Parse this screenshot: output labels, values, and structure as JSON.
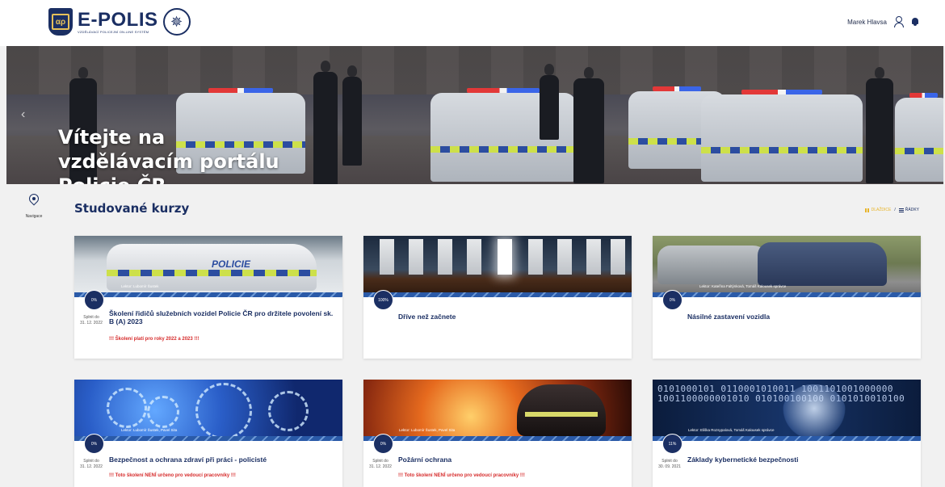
{
  "header": {
    "logo_title": "E-POLIS",
    "logo_subtitle": "VZDĚLÁVACÍ POLICEJNÍ ON-LINE SYSTÉM",
    "user_name": "Marek Hlavsa"
  },
  "hero": {
    "title": "Vítejte na vzdělávacím portálu Policie ČR"
  },
  "leftnav": {
    "label": "Navigace"
  },
  "section": {
    "title": "Studované kurzy",
    "view_tiles": "DLAŽDICE",
    "view_separator": "/",
    "view_rows": "ŘÁDKY"
  },
  "due_label": "Splnit do",
  "courses": [
    {
      "progress": "0%",
      "due_date": "31. 12. 2022",
      "lektor": "Lektor: Lubomír Šustek",
      "title": "Školení řidičů služebních vozidel Policie ČR pro držitele povolení sk. B (A) 2023",
      "note": "!!! Školení platí pro roky 2022 a 2023 !!!",
      "image_text": "POLICIE"
    },
    {
      "progress": "100%",
      "due_date": "",
      "lektor": "",
      "title": "Dříve než začnete",
      "note": ""
    },
    {
      "progress": "0%",
      "due_date": "",
      "lektor": "Lektor: Kateřina Faltýnková, Tomáš Kalousek správce",
      "title": "Násilné zastavení vozidla",
      "note": ""
    },
    {
      "progress": "0%",
      "due_date": "31. 12. 2022",
      "lektor": "Lektor: Lubomír Šustek, Pavel Sita",
      "title": "Bezpečnost a ochrana zdraví při práci - policisté",
      "note": "!!! Toto školení NENÍ určeno pro vedoucí pracovníky !!!"
    },
    {
      "progress": "0%",
      "due_date": "31. 12. 2022",
      "lektor": "Lektor: Lubomír Šustek, Pavel Sita",
      "title": "Požární ochrana",
      "note": "!!! Toto školení NENÍ určeno pro vedoucí pracovníky !!!"
    },
    {
      "progress": "11%",
      "due_date": "30. 09. 2021",
      "lektor": "Lektor: Eliška Rozsypalová, Tomáš Kalousek správce",
      "title": "Základy kybernetické bezpečnosti",
      "note": "",
      "image_text": "0101000101 0110001010011 1001101001000000 1001100000001010 010100100100 0101010010100"
    }
  ],
  "colors": {
    "brand_navy": "#1b2f63",
    "accent_yellow": "#e8b52a",
    "warning_red": "#d62b2b",
    "page_bg": "#f1f1f1"
  },
  "icons": {
    "user": "user-icon",
    "bell": "bell-icon",
    "nav": "location-pin-icon",
    "tiles": "tiles-icon",
    "rows": "rows-icon"
  }
}
